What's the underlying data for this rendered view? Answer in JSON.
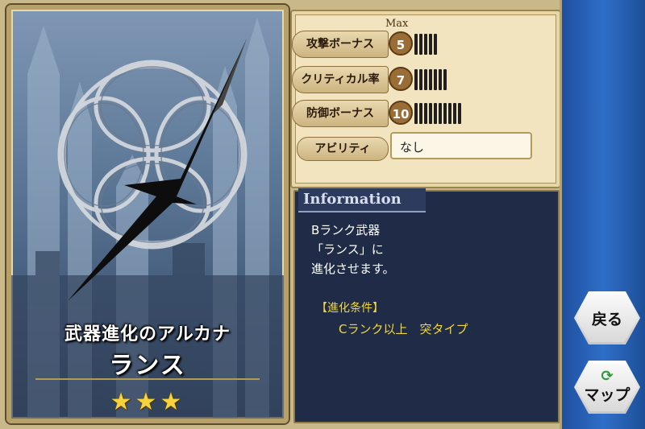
{
  "card": {
    "title": "武器進化のアルカナ",
    "name": "ランス",
    "stars": "★★★"
  },
  "stats": {
    "max_label": "Max",
    "rows": [
      {
        "label": "攻撃ボーナス",
        "value": "5",
        "level": 5
      },
      {
        "label": "クリティカル率",
        "value": "7",
        "level": 7
      },
      {
        "label": "防御ボーナス",
        "value": "10",
        "level": 10
      }
    ],
    "ability_label": "アビリティ",
    "ability_value": "なし"
  },
  "info": {
    "tab_label": "Information",
    "line1": "Bランク武器",
    "line2": "「ランス」に",
    "line3": "進化させます。",
    "condition_title": "【進化条件】",
    "condition_body": "Cランク以上　突タイプ"
  },
  "nav": {
    "back_label": "戻る",
    "map_label": "マップ"
  },
  "colors": {
    "star": "#f6d33c",
    "condition_text": "#f2d83a",
    "info_bg": "#1f2b47",
    "side_bg": "#2f6fc8",
    "refresh_icon": "#2e9a3a"
  },
  "icons": [
    "refresh-icon",
    "weapon-lance-icon",
    "star-icon"
  ]
}
